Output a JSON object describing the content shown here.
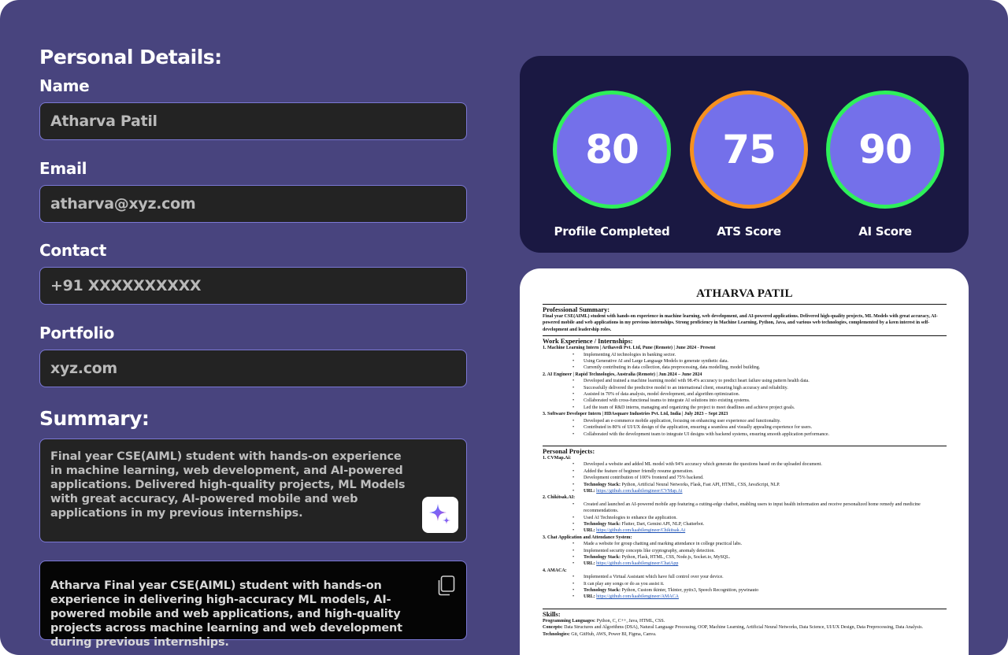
{
  "personal": {
    "title": "Personal Details:",
    "name_label": "Name",
    "name_value": "Atharva Patil",
    "email_label": "Email",
    "email_value": "atharva@xyz.com",
    "contact_label": "Contact",
    "contact_value": "+91 XXXXXXXXXX",
    "portfolio_label": "Portfolio",
    "portfolio_value": "xyz.com"
  },
  "summary": {
    "title": "Summary:",
    "text": "Final year CSE(AIML) student with hands-on experience in machine learning, web development, and AI-powered applications. Delivered high-quality projects, ML Models with great accuracy, AI-powered mobile and web applications in my previous internships.",
    "generated": "Atharva Final year CSE(AIML) student with hands-on experience in delivering high-accuracy ML models, AI-powered mobile and web applications, and high-quality projects across machine learning and web development during previous internships."
  },
  "scores": [
    {
      "value": "80",
      "label": "Profile Completed",
      "color": "#2ef05a"
    },
    {
      "value": "75",
      "label": "ATS Score",
      "color": "#f7901e"
    },
    {
      "value": "90",
      "label": "AI Score",
      "color": "#2ef05a"
    }
  ],
  "resume": {
    "name": "ATHARVA PATIL",
    "summary_heading": "Professional Summary:",
    "summary_text": "Final year CSE(AIML) student with hands-on experience in machine learning, web development, and AI-powered applications. Delivered high-quality projects, ML Models with great accuracy, AI-powered mobile and web applications in my previous internships. Strong proficiency in Machine Learning, Python, Java, and various web technologies, complemented by a keen interest in self-development and leadership roles.",
    "work_heading": "Work Experience / Internships:",
    "jobs": [
      {
        "title": "1. Machine Learning Intern | Arthavedi Pvt. Ltd, Pune (Remote) | June 2024 - Present",
        "bullets": [
          "Implementing AI technologies in banking sector.",
          "Using Generative AI and Large Language Models to generate synthetic data.",
          "Currently contributing in data collection, data preprocessing, data modelling, model building."
        ]
      },
      {
        "title": "2. AI Engineer | Rapid Technologies, Australia (Remote) | Jun 2024 – June 2024",
        "bullets": [
          "Developed and trained a machine learning model with 98.4% accuracy to predict heart failure using pattern health data.",
          "Successfully delivered the predictive model to an international client, ensuring high accuracy and reliability.",
          "Assisted in 70% of data analysis, model development, and algorithm optimization.",
          "Collaborated with cross-functional teams to integrate AI solutions into existing systems.",
          "Led the team of R&D interns, managing and organizing the project to meet deadlines and achieve project goals."
        ]
      },
      {
        "title": "3. Software Developer Intern | HDAsquare Industries Pvt. Ltd, India | July 2023 – Sept 2023",
        "bullets": [
          "Developed an e-commerce mobile application, focusing on enhancing user experience and functionality.",
          "Contributed in 80% of UI/UX design of the application, ensuring a seamless and visually appealing experience for users.",
          "Collaborated with the development team to integrate UI designs with backend systems, ensuring smooth application performance."
        ]
      }
    ],
    "projects_heading": "Personal Projects:",
    "projects": [
      {
        "title": "1. CVMap.Ai:",
        "bullets": [
          "Developed a website and added ML model with 94% accuracy which generate the questions based on the uploaded document.",
          "Added the feature of beginner friendly resume generation.",
          "Development contribution of 100% frontend and 75% backend."
        ],
        "stack_label": "Technology Stack:",
        "stack": "Python, Artificial Neural Networks, Flask, Fast API, HTML, CSS, JavaScript, NLP.",
        "url_label": "URL:",
        "url": "https://github.com/kaabilengineer/CVMap.Ai"
      },
      {
        "title": "2. Chikitsak.AI:",
        "bullets": [
          "Created and launched an AI-powered mobile app featuring a cutting-edge chatbot, enabling users to input health information and receive personalized home remedy and medicine recommendations.",
          "Used AI Technologies to enhance the application."
        ],
        "stack_label": "Technology Stack:",
        "stack": "Flutter, Dart, Gemini API, NLP, Chatterbot.",
        "url_label": "URL:",
        "url": "https://github.com/kaabilengineer/Chikitsak.Ai"
      },
      {
        "title": "3. Chat Application and Attendance System:",
        "bullets": [
          "Made a website for group chatting and marking attendance in college practical labs.",
          "Implemented security concepts like cryptography, anomaly detection."
        ],
        "stack_label": "Technology Stack:",
        "stack": "Python, Flask, HTML, CSS, Node.js, Socket.io, MySQL.",
        "url_label": "URL:",
        "url": "https://github.com/kaabilengineer/ChatApp"
      },
      {
        "title": "4. AMACA:",
        "bullets": [
          "Implemented a Virtual Assistant which have full control over your device.",
          "It can play any songs or do as you assist it."
        ],
        "stack_label": "Technology Stack:",
        "stack": "Python, Custom tkinter, Tkinter, pyttx3, Speech Recognition, pywinauto",
        "url_label": "URL:",
        "url": "https://github.com/kaabilengineer/AMACA"
      }
    ],
    "skills_heading": "Skills:",
    "skills": [
      {
        "label": "Programming Languages:",
        "value": "Python, C, C++, Java, HTML, CSS."
      },
      {
        "label": "Concepts:",
        "value": "Data Structures and Algorithms (DSA), Natural Language Processing, OOP, Machine Learning, Artificial Neural Networks, Data Science, UI/UX Design, Data Preprocessing, Data Analysis."
      },
      {
        "label": "Technologies:",
        "value": "Git, GitHub, AWS, Power BI, Figma, Canva."
      }
    ]
  }
}
